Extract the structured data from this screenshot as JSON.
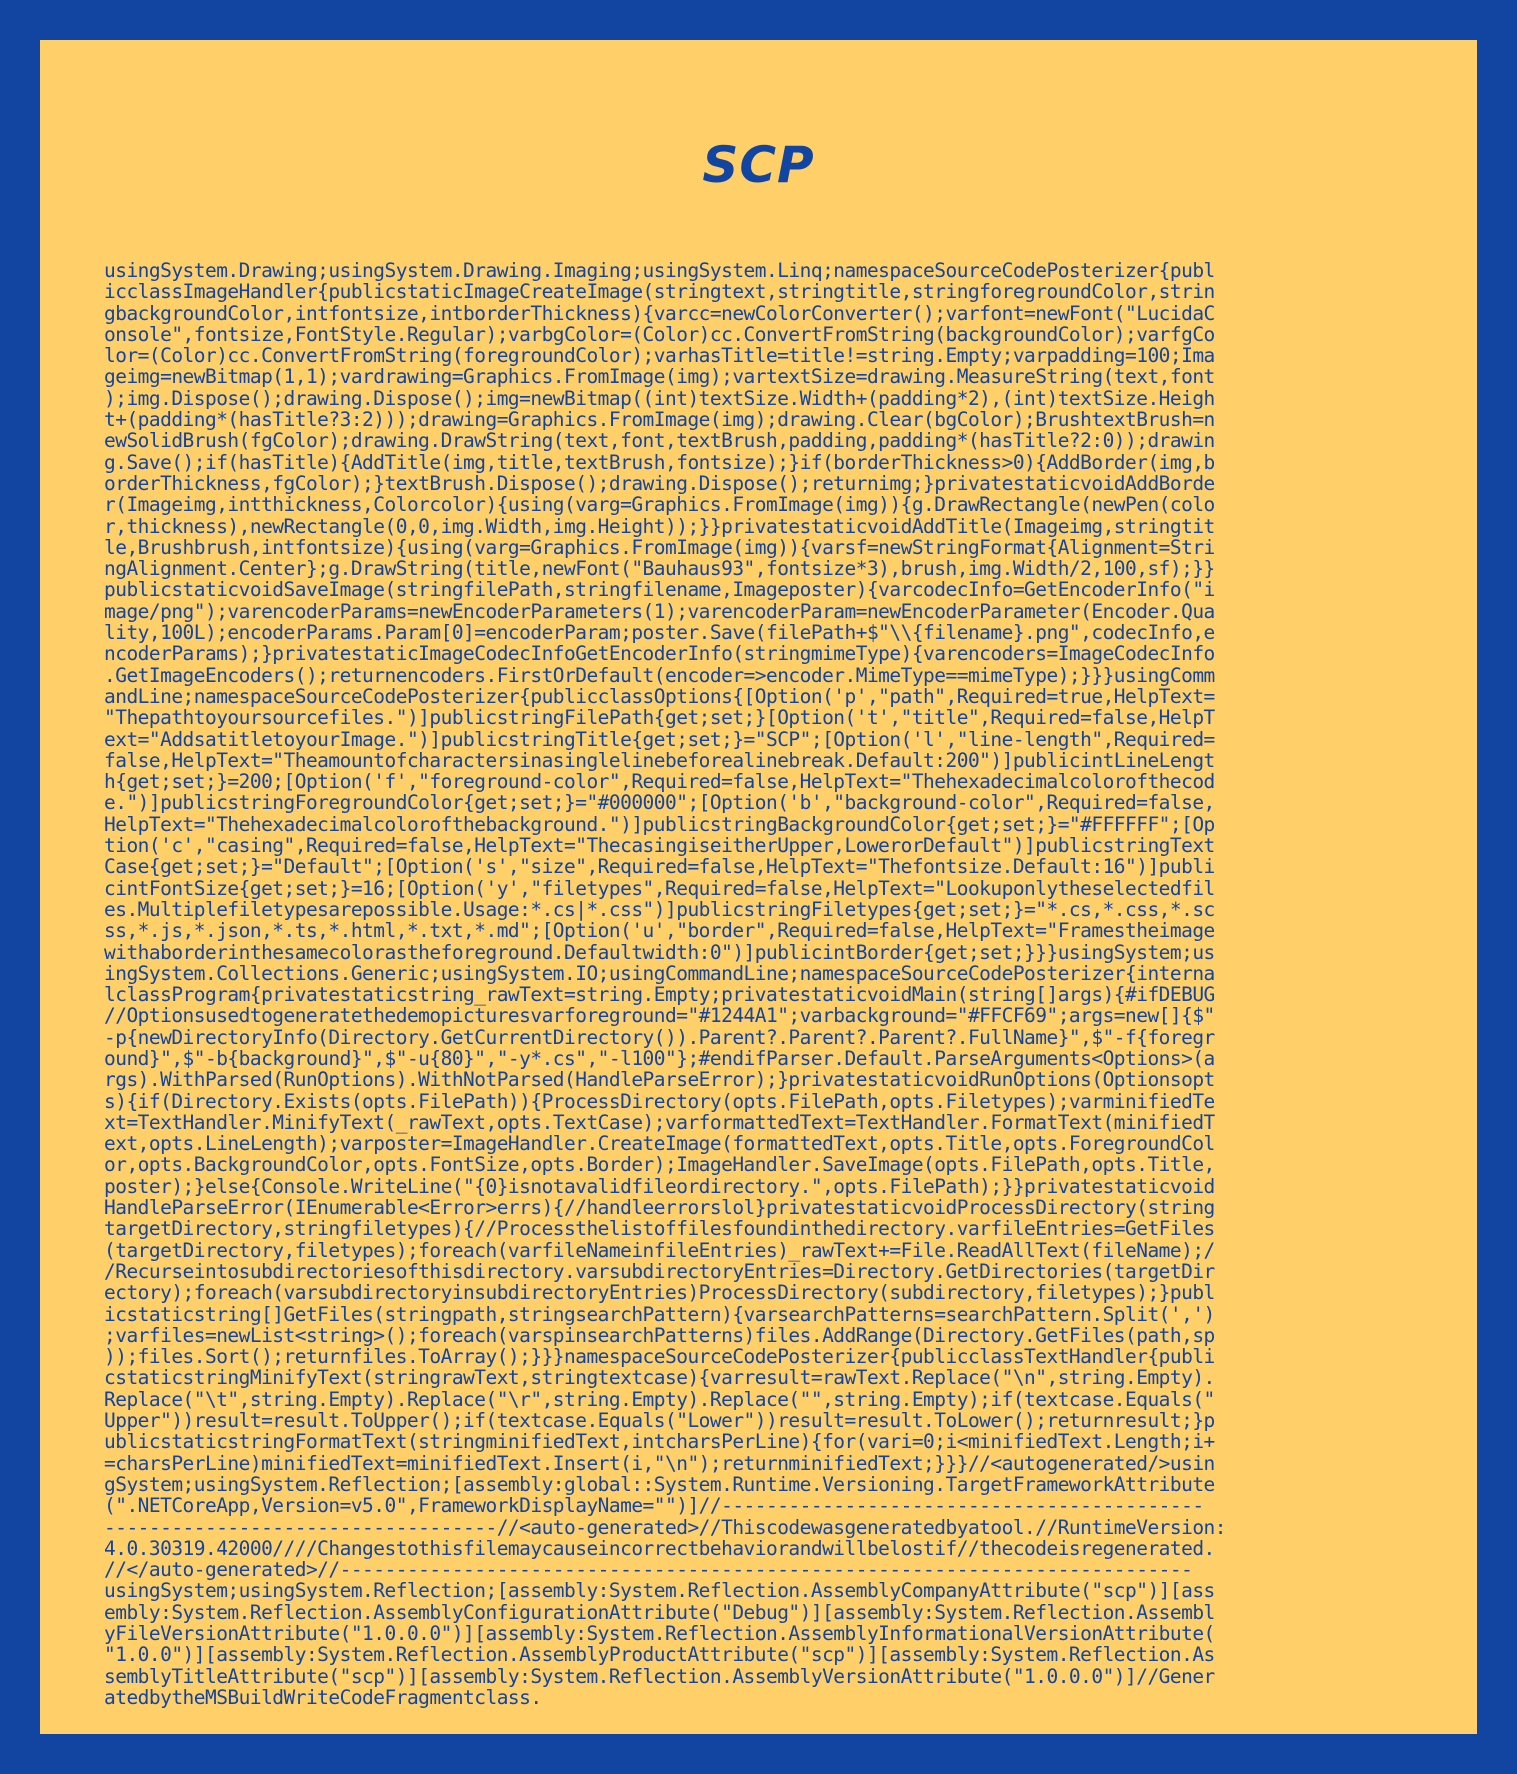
{
  "poster": {
    "title": "SCP",
    "colors": {
      "foreground": "#1244A1",
      "background": "#FFCF69",
      "border": "#1244A1"
    },
    "lines": [
      "usingSystem.Drawing;usingSystem.Drawing.Imaging;usingSystem.Linq;namespaceSourceCodePosterizer{publ",
      "icclassImageHandler{publicstaticImageCreateImage(stringtext,stringtitle,stringforegroundColor,strin",
      "gbackgroundColor,intfontsize,intborderThickness){varcc=newColorConverter();varfont=newFont(\"LucidaC",
      "onsole\",fontsize,FontStyle.Regular);varbgColor=(Color)cc.ConvertFromString(backgroundColor);varfgCo",
      "lor=(Color)cc.ConvertFromString(foregroundColor);varhasTitle=title!=string.Empty;varpadding=100;Ima",
      "geimg=newBitmap(1,1);vardrawing=Graphics.FromImage(img);vartextSize=drawing.MeasureString(text,font",
      ");img.Dispose();drawing.Dispose();img=newBitmap((int)textSize.Width+(padding*2),(int)textSize.Heigh",
      "t+(padding*(hasTitle?3:2)));drawing=Graphics.FromImage(img);drawing.Clear(bgColor);BrushtextBrush=n",
      "ewSolidBrush(fgColor);drawing.DrawString(text,font,textBrush,padding,padding*(hasTitle?2:0));drawin",
      "g.Save();if(hasTitle){AddTitle(img,title,textBrush,fontsize);}if(borderThickness>0){AddBorder(img,b",
      "orderThickness,fgColor);}textBrush.Dispose();drawing.Dispose();returnimg;}privatestaticvoidAddBorde",
      "r(Imageimg,intthickness,Colorcolor){using(varg=Graphics.FromImage(img)){g.DrawRectangle(newPen(colo",
      "r,thickness),newRectangle(0,0,img.Width,img.Height));}}privatestaticvoidAddTitle(Imageimg,stringtit",
      "le,Brushbrush,intfontsize){using(varg=Graphics.FromImage(img)){varsf=newStringFormat{Alignment=Stri",
      "ngAlignment.Center};g.DrawString(title,newFont(\"Bauhaus93\",fontsize*3),brush,img.Width/2,100,sf);}}",
      "publicstaticvoidSaveImage(stringfilePath,stringfilename,Imageposter){varcodecInfo=GetEncoderInfo(\"i",
      "mage/png\");varencoderParams=newEncoderParameters(1);varencoderParam=newEncoderParameter(Encoder.Qua",
      "lity,100L);encoderParams.Param[0]=encoderParam;poster.Save(filePath+$\"\\\\{filename}.png\",codecInfo,e",
      "ncoderParams);}privatestaticImageCodecInfoGetEncoderInfo(stringmimeType){varencoders=ImageCodecInfo",
      ".GetImageEncoders();returnencoders.FirstOrDefault(encoder=>encoder.MimeType==mimeType);}}}usingComm",
      "andLine;namespaceSourceCodePosterizer{publicclassOptions{[Option('p',\"path\",Required=true,HelpText=",
      "\"Thepathtoyoursourcefiles.\")]publicstringFilePath{get;set;}[Option('t',\"title\",Required=false,HelpT",
      "ext=\"AddsatitletoyourImage.\")]publicstringTitle{get;set;}=\"SCP\";[Option('l',\"line-length\",Required=",
      "false,HelpText=\"Theamountofcharactersinasinglelinebeforealinebreak.Default:200\")]publicintLineLengt",
      "h{get;set;}=200;[Option('f',\"foreground-color\",Required=false,HelpText=\"Thehexadecimalcolorofthecod",
      "e.\")]publicstringForegroundColor{get;set;}=\"#000000\";[Option('b',\"background-color\",Required=false,",
      "HelpText=\"Thehexadecimalcolorofthebackground.\")]publicstringBackgroundColor{get;set;}=\"#FFFFFF\";[Op",
      "tion('c',\"casing\",Required=false,HelpText=\"ThecasingiseitherUpper,LowerorDefault\")]publicstringText",
      "Case{get;set;}=\"Default\";[Option('s',\"size\",Required=false,HelpText=\"Thefontsize.Default:16\")]publi",
      "cintFontSize{get;set;}=16;[Option('y',\"filetypes\",Required=false,HelpText=\"Lookuponlytheselectedfil",
      "es.Multiplefiletypesarepossible.Usage:*.cs|*.css\")]publicstringFiletypes{get;set;}=\"*.cs,*.css,*.sc",
      "ss,*.js,*.json,*.ts,*.html,*.txt,*.md\";[Option('u',\"border\",Required=false,HelpText=\"Framestheimage",
      "withaborderinthesamecolorastheforeground.Defaultwidth:0\")]publicintBorder{get;set;}}}usingSystem;us",
      "ingSystem.Collections.Generic;usingSystem.IO;usingCommandLine;namespaceSourceCodePosterizer{interna",
      "lclassProgram{privatestaticstring_rawText=string.Empty;privatestaticvoidMain(string[]args){#ifDEBUG",
      "//Optionsusedtogeneratethedemopicturesvarforeground=\"#1244A1\";varbackground=\"#FFCF69\";args=new[]{$\"",
      "-p{newDirectoryInfo(Directory.GetCurrentDirectory()).Parent?.Parent?.Parent?.FullName}\",$\"-f{foregr",
      "ound}\",$\"-b{background}\",$\"-u{80}\",\"-y*.cs\",\"-l100\"};#endifParser.Default.ParseArguments<Options>(a",
      "rgs).WithParsed(RunOptions).WithNotParsed(HandleParseError);}privatestaticvoidRunOptions(Optionsopt",
      "s){if(Directory.Exists(opts.FilePath)){ProcessDirectory(opts.FilePath,opts.Filetypes);varminifiedTe",
      "xt=TextHandler.MinifyText(_rawText,opts.TextCase);varformattedText=TextHandler.FormatText(minifiedT",
      "ext,opts.LineLength);varposter=ImageHandler.CreateImage(formattedText,opts.Title,opts.ForegroundCol",
      "or,opts.BackgroundColor,opts.FontSize,opts.Border);ImageHandler.SaveImage(opts.FilePath,opts.Title,",
      "poster);}else{Console.WriteLine(\"{0}isnotavalidfileordirectory.\",opts.FilePath);}}privatestaticvoid",
      "HandleParseError(IEnumerable<Error>errs){//handleerrorslol}privatestaticvoidProcessDirectory(string",
      "targetDirectory,stringfiletypes){//Processthelistoffilesfoundinthedirectory.varfileEntries=GetFiles",
      "(targetDirectory,filetypes);foreach(varfileNameinfileEntries)_rawText+=File.ReadAllText(fileName);/",
      "/Recurseintosubdirectoriesofthisdirectory.varsubdirectoryEntries=Directory.GetDirectories(targetDir",
      "ectory);foreach(varsubdirectoryinsubdirectoryEntries)ProcessDirectory(subdirectory,filetypes);}publ",
      "icstaticstring[]GetFiles(stringpath,stringsearchPattern){varsearchPatterns=searchPattern.Split(',')",
      ";varfiles=newList<string>();foreach(varspinsearchPatterns)files.AddRange(Directory.GetFiles(path,sp",
      "));files.Sort();returnfiles.ToArray();}}}namespaceSourceCodePosterizer{publicclassTextHandler{publi",
      "cstaticstringMinifyText(stringrawText,stringtextcase){varresult=rawText.Replace(\"\\n\",string.Empty).",
      "Replace(\"\\t\",string.Empty).Replace(\"\\r\",string.Empty).Replace(\"\",string.Empty);if(textcase.Equals(\"",
      "Upper\"))result=result.ToUpper();if(textcase.Equals(\"Lower\"))result=result.ToLower();returnresult;}p",
      "ublicstaticstringFormatText(stringminifiedText,intcharsPerLine){for(vari=0;i<minifiedText.Length;i+",
      "=charsPerLine)minifiedText=minifiedText.Insert(i,\"\\n\");returnminifiedText;}}}//<autogenerated/>usin",
      "gSystem;usingSystem.Reflection;[assembly:global::System.Runtime.Versioning.TargetFrameworkAttribute",
      "(\".NETCoreApp,Version=v5.0\",FrameworkDisplayName=\"\")]//-------------------------------------------",
      "-----------------------------------//<auto-generated>//Thiscodewasgeneratedbyatool.//RuntimeVersion:",
      "4.0.30319.42000////Changestothisfilemaycauseincorrectbehaviorandwillbelostif//thecodeisregenerated.",
      "//</auto-generated>//----------------------------------------------------------------------------",
      "usingSystem;usingSystem.Reflection;[assembly:System.Reflection.AssemblyCompanyAttribute(\"scp\")][ass",
      "embly:System.Reflection.AssemblyConfigurationAttribute(\"Debug\")][assembly:System.Reflection.Assembl",
      "yFileVersionAttribute(\"1.0.0.0\")][assembly:System.Reflection.AssemblyInformationalVersionAttribute(",
      "\"1.0.0\")][assembly:System.Reflection.AssemblyProductAttribute(\"scp\")][assembly:System.Reflection.As",
      "semblyTitleAttribute(\"scp\")][assembly:System.Reflection.AssemblyVersionAttribute(\"1.0.0.0\")]//Gener",
      "atedbytheMSBuildWriteCodeFragmentclass."
    ]
  }
}
